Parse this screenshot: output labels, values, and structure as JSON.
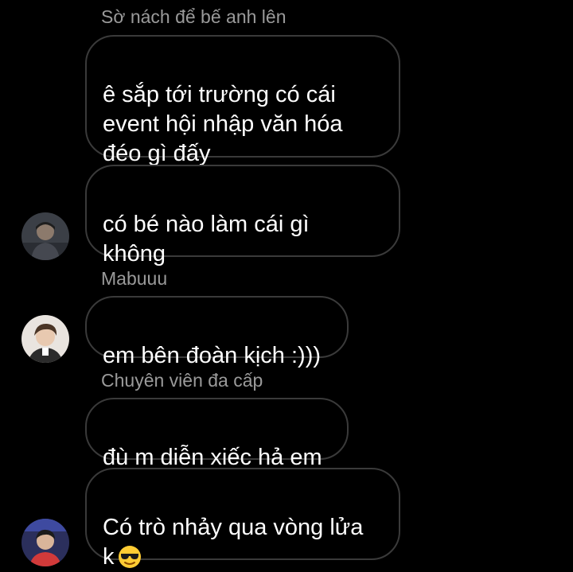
{
  "chat": {
    "groups": [
      {
        "sender": "Sờ nách để bế anh lên",
        "messages": [
          "ê sắp tới trường có cái\nevent hội nhập văn hóa\nđéo gì đấy",
          "có bé nào làm cái gì\nkhông"
        ],
        "avatar_icon": "avatar-user-1-icon"
      },
      {
        "sender": "Mabuuu",
        "messages": [
          "em bên đoàn kịch :)))"
        ],
        "avatar_icon": "avatar-user-2-icon"
      },
      {
        "sender": "Chuyên viên đa cấp",
        "messages": [
          "đù m diễn xiếc hả em"
        ],
        "avatar_icon": "none"
      },
      {
        "sender": "",
        "messages": [
          "Có trò nhảy qua vòng lửa\nk"
        ],
        "trailing_emoji": "smiling-face-with-sunglasses-emoji",
        "avatar_icon": "avatar-user-3-icon"
      }
    ]
  },
  "colors": {
    "background": "#000000",
    "bubble_border": "#3a3a3a",
    "message_text": "#ffffff",
    "sender_text": "#9a9a9a"
  }
}
